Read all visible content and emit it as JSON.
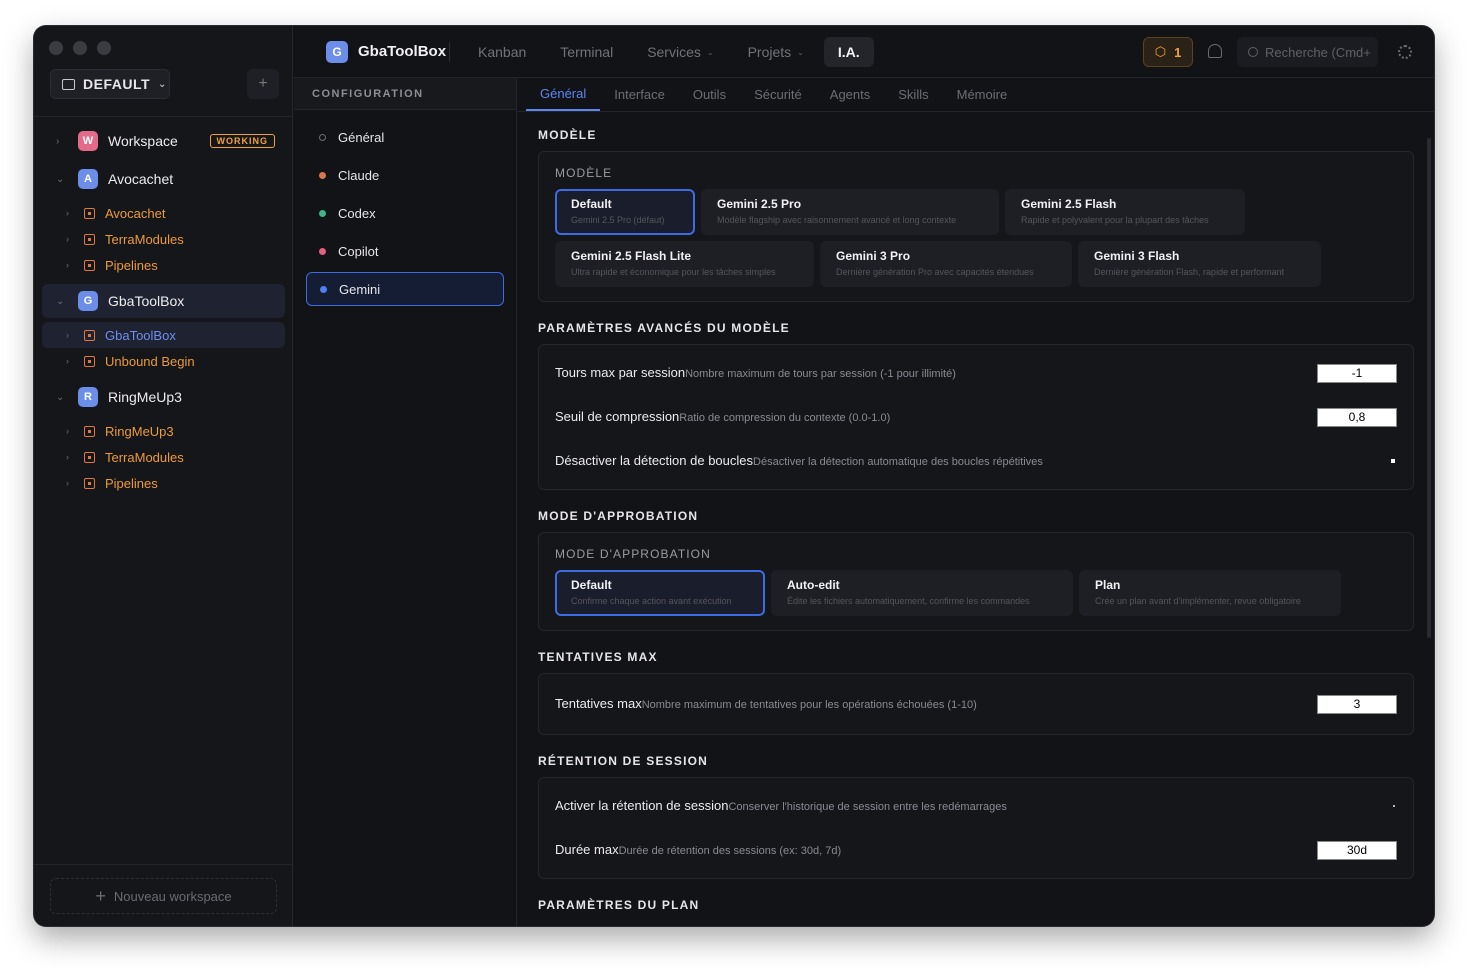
{
  "workspace_selector": {
    "label": "DEFAULT"
  },
  "sidebar": {
    "add_label": "+",
    "new_workspace_label": "Nouveau workspace",
    "workspaces": [
      {
        "label": "Workspace",
        "initial": "W",
        "color": "#e46a8c",
        "badge": "WORKING",
        "expanded": false,
        "projects": []
      },
      {
        "label": "Avocachet",
        "initial": "A",
        "color": "#6c8de8",
        "expanded": true,
        "projects": [
          "Avocachet",
          "TerraModules",
          "Pipelines"
        ]
      },
      {
        "label": "GbaToolBox",
        "initial": "G",
        "color": "#6c8de8",
        "expanded": true,
        "active": true,
        "projects": [
          "GbaToolBox",
          "Unbound Begin"
        ]
      },
      {
        "label": "RingMeUp3",
        "initial": "R",
        "color": "#6c8de8",
        "expanded": true,
        "projects": [
          "RingMeUp3",
          "TerraModules",
          "Pipelines"
        ]
      }
    ]
  },
  "header": {
    "app_initial": "G",
    "app_name": "GbaToolBox",
    "nav": [
      {
        "label": "Kanban"
      },
      {
        "label": "Terminal"
      },
      {
        "label": "Services",
        "dropdown": true
      },
      {
        "label": "Projets",
        "dropdown": true
      },
      {
        "label": "I.A.",
        "active": true
      }
    ],
    "notification_count": "1",
    "search_placeholder": "Recherche (Cmd+"
  },
  "config": {
    "title": "CONFIGURATION",
    "providers": [
      {
        "label": "Général",
        "dot": "#6d6e75"
      },
      {
        "label": "Claude",
        "dot": "#d9774a"
      },
      {
        "label": "Codex",
        "dot": "#3fb489"
      },
      {
        "label": "Copilot",
        "dot": "#e0607e"
      },
      {
        "label": "Gemini",
        "dot": "#4f7ff0",
        "active": true
      }
    ]
  },
  "tabs": [
    "Général",
    "Interface",
    "Outils",
    "Sécurité",
    "Agents",
    "Skills",
    "Mémoire"
  ],
  "sections": {
    "model": {
      "title": "MODÈLE",
      "label": "MODÈLE",
      "options": [
        {
          "title": "Default",
          "desc": "Gemini 2.5 Pro (défaut)",
          "active": true
        },
        {
          "title": "Gemini 2.5 Pro",
          "desc": "Modèle flagship avec raisonnement avancé et long contexte"
        },
        {
          "title": "Gemini 2.5 Flash",
          "desc": "Rapide et polyvalent pour la plupart des tâches"
        },
        {
          "title": "Gemini 2.5 Flash Lite",
          "desc": "Ultra rapide et économique pour les tâches simples"
        },
        {
          "title": "Gemini 3 Pro",
          "desc": "Dernière génération Pro avec capacités étendues"
        },
        {
          "title": "Gemini 3 Flash",
          "desc": "Dernière génération Flash, rapide et performant"
        }
      ]
    },
    "advanced": {
      "title": "PARAMÈTRES AVANCÉS DU MODÈLE",
      "max_turns": {
        "label": "Tours max par session",
        "desc": "Nombre maximum de tours par session (-1 pour illimité)",
        "value": "-1"
      },
      "compression": {
        "label": "Seuil de compression",
        "desc": "Ratio de compression du contexte (0.0-1.0)",
        "value": "0,8"
      },
      "loop_detection": {
        "label": "Désactiver la détection de boucles",
        "desc": "Désactiver la détection automatique des boucles répétitives"
      }
    },
    "approval": {
      "title": "MODE D'APPROBATION",
      "label": "MODE D'APPROBATION",
      "options": [
        {
          "title": "Default",
          "desc": "Confirme chaque action avant exécution",
          "active": true
        },
        {
          "title": "Auto-edit",
          "desc": "Édite les fichiers automatiquement, confirme les commandes"
        },
        {
          "title": "Plan",
          "desc": "Crée un plan avant d'implémenter, revue obligatoire"
        }
      ]
    },
    "retries": {
      "title": "TENTATIVES MAX",
      "max": {
        "label": "Tentatives max",
        "desc": "Nombre maximum de tentatives pour les opérations échouées (1-10)",
        "value": "3"
      }
    },
    "retention": {
      "title": "RÉTENTION DE SESSION",
      "enable": {
        "label": "Activer la rétention de session",
        "desc": "Conserver l'historique de session entre les redémarrages"
      },
      "duration": {
        "label": "Durée max",
        "desc": "Durée de rétention des sessions (ex: 30d, 7d)",
        "value": "30d"
      }
    },
    "plan": {
      "title": "PARAMÈTRES DU PLAN"
    }
  }
}
